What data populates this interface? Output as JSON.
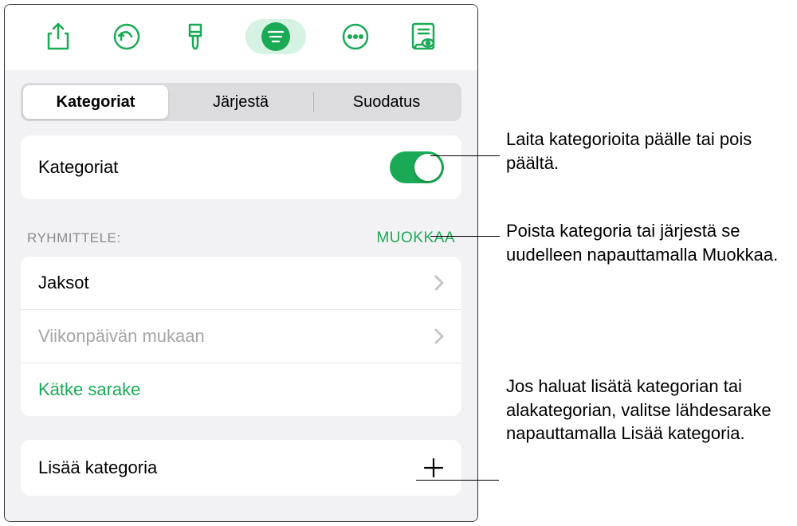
{
  "toolbar": {
    "icons": [
      "share-icon",
      "undo-icon",
      "brush-icon",
      "sort-icon",
      "more-icon",
      "read-icon"
    ]
  },
  "segments": {
    "categories": "Kategoriat",
    "sort": "Järjestä",
    "filter": "Suodatus"
  },
  "categoriesCard": {
    "label": "Kategoriat"
  },
  "groupBy": {
    "header": "RYHMITTELE:",
    "edit": "MUOKKAA",
    "rows": [
      {
        "label": "Jaksot",
        "dim": false
      },
      {
        "label_1": "Viikonpäivän ",
        "label_2": "mukaan",
        "dim": true
      }
    ],
    "hide": "Kätke sarake"
  },
  "addCategory": {
    "label": "Lisää kategoria"
  },
  "annotations": {
    "a1": "Laita kategorioita päälle tai pois päältä.",
    "a2": "Poista kategoria tai järjestä se uudelleen napauttamalla Muokkaa.",
    "a3": "Jos haluat lisätä kategorian tai alakategorian, valitse lähdesarake napauttamalla Lisää kategoria."
  }
}
